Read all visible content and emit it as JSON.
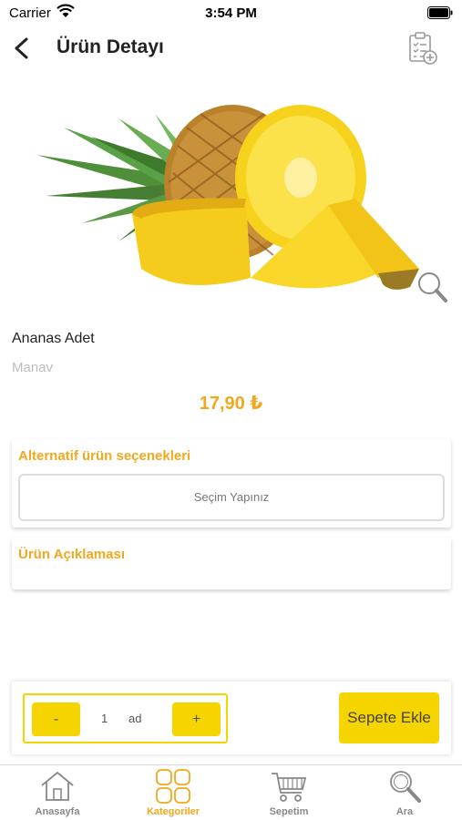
{
  "status_bar": {
    "carrier": "Carrier",
    "time": "3:54 PM"
  },
  "header": {
    "title": "Ürün Detayı"
  },
  "product": {
    "name": "Ananas Adet",
    "category": "Manav",
    "price": "17,90 ₺"
  },
  "alternatives": {
    "title": "Alternatif ürün seçenekleri",
    "select_placeholder": "Seçim Yapınız"
  },
  "description": {
    "title": "Ürün Açıklaması"
  },
  "cart_bar": {
    "minus_label": "-",
    "quantity": "1",
    "unit": "ad",
    "plus_label": "+",
    "add_to_cart_label": "Sepete Ekle"
  },
  "tab_bar": {
    "items": [
      {
        "label": "Anasayfa",
        "icon": "home-icon"
      },
      {
        "label": "Kategoriler",
        "icon": "categories-icon"
      },
      {
        "label": "Sepetim",
        "icon": "cart-icon"
      },
      {
        "label": "Ara",
        "icon": "search-icon"
      }
    ],
    "active_index": 1
  },
  "colors": {
    "accent": "#f2a81d",
    "button_yellow": "#f5d400",
    "muted": "#bdbdbd"
  }
}
